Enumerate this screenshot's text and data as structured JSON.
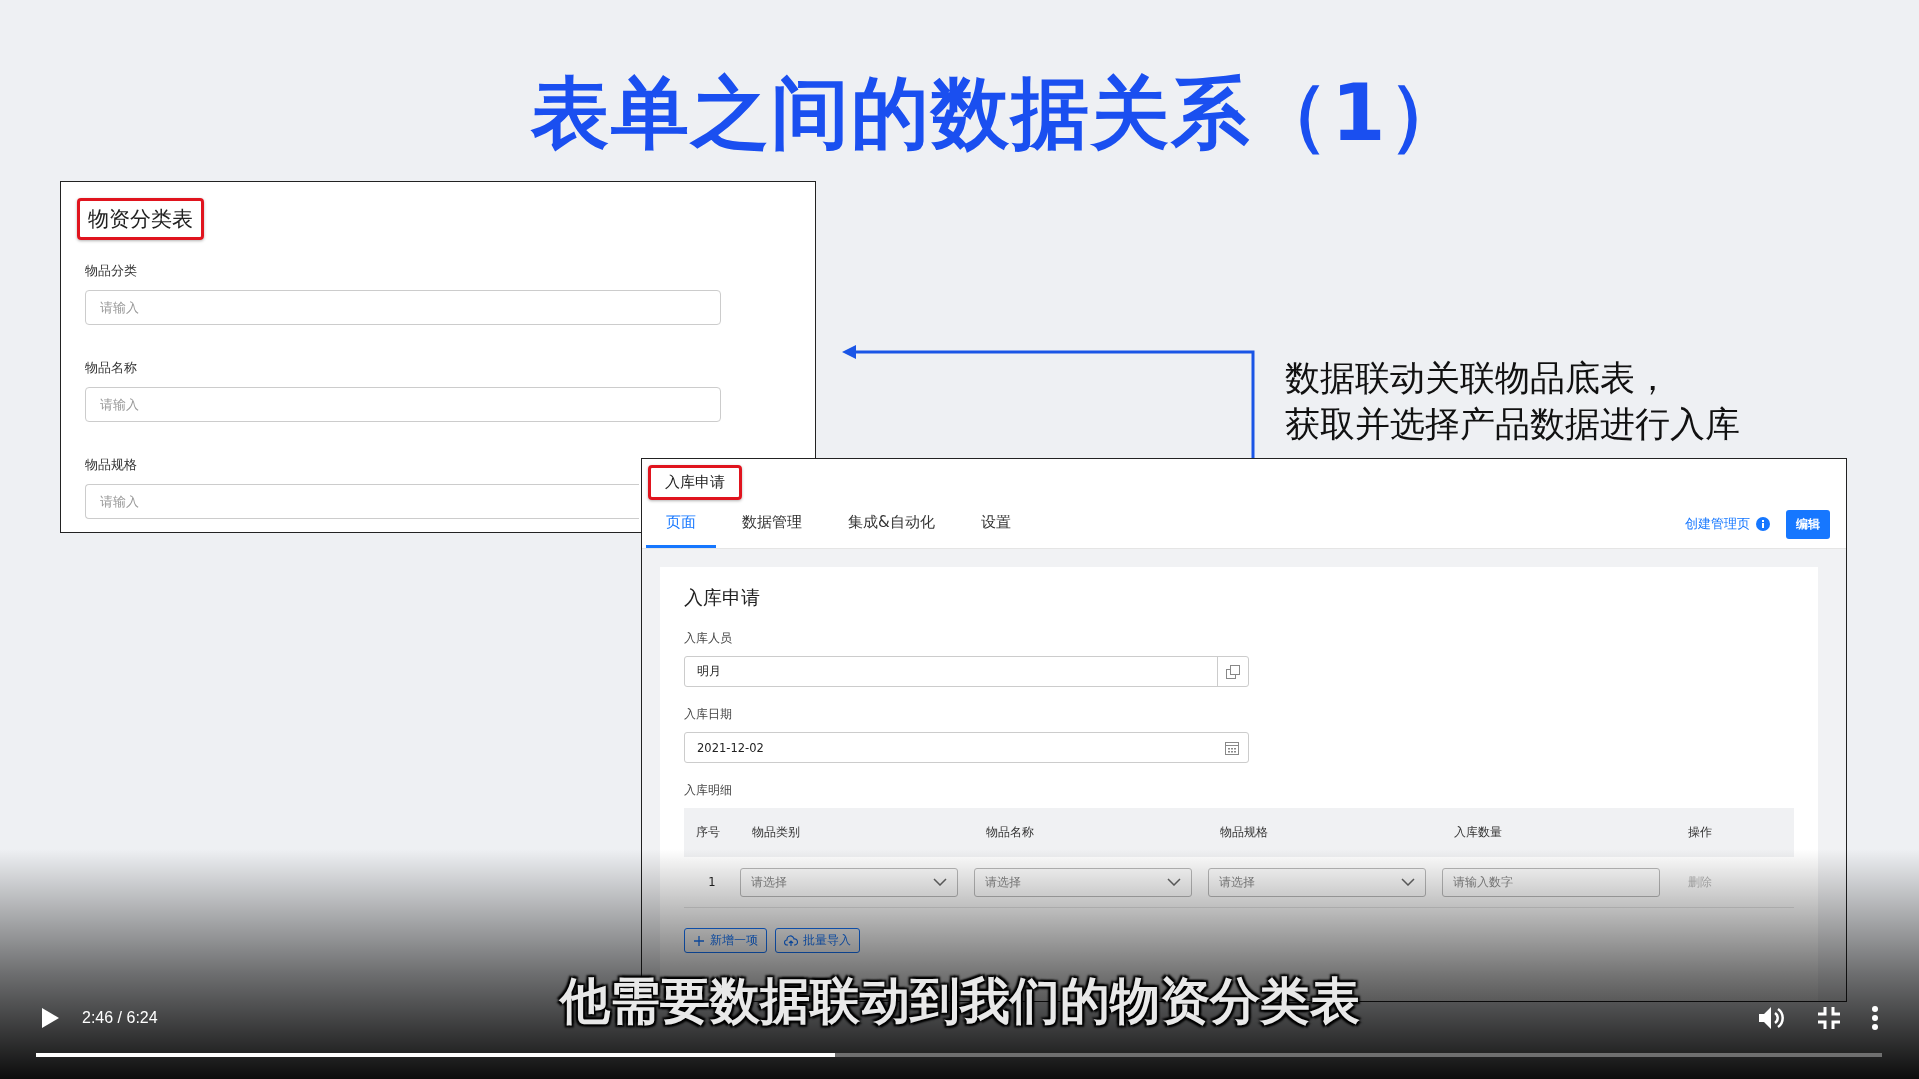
{
  "slide": {
    "title": "表单之间的数据关系（1）",
    "annotation_lines": [
      "数据联动关联物品底表，",
      "获取并选择产品数据进行入库"
    ],
    "source_form": {
      "title": "物资分类表",
      "highlighted": true,
      "fields": [
        {
          "label": "物品分类",
          "placeholder": "请输入"
        },
        {
          "label": "物品名称",
          "placeholder": "请输入"
        },
        {
          "label": "物品规格",
          "placeholder": "请输入"
        }
      ]
    },
    "target_app": {
      "title": "入库申请",
      "highlighted": true,
      "tabs": [
        {
          "label": "页面",
          "selected": true
        },
        {
          "label": "数据管理",
          "selected": false
        },
        {
          "label": "集成&自动化",
          "selected": false
        },
        {
          "label": "设置",
          "selected": false
        }
      ],
      "create_link": "创建管理页",
      "edit_button": "编辑",
      "form": {
        "title": "入库申请",
        "fields": [
          {
            "kind": "picker",
            "label": "入库人员",
            "value": "明月"
          },
          {
            "kind": "date",
            "label": "入库日期",
            "value": "2021-12-02"
          }
        ],
        "table": {
          "label": "入库明细",
          "columns": [
            "序号",
            "物品类别",
            "物品名称",
            "物品规格",
            "入库数量",
            "操作"
          ],
          "rows": [
            {
              "cells": [
                {
                  "kind": "index",
                  "text": "1"
                },
                {
                  "kind": "select",
                  "placeholder": "请选择"
                },
                {
                  "kind": "select",
                  "placeholder": "请选择"
                },
                {
                  "kind": "select",
                  "placeholder": "请选择"
                },
                {
                  "kind": "number",
                  "placeholder": "请输入数字"
                },
                {
                  "kind": "action",
                  "text": "删除",
                  "disabled": true
                }
              ]
            }
          ],
          "buttons": [
            {
              "kind": "add",
              "label": "新增一项"
            },
            {
              "kind": "import",
              "label": "批量导入"
            }
          ]
        }
      }
    }
  },
  "player": {
    "playing": false,
    "time": "2:46 / 6:24",
    "subtitle": "他需要数据联动到我们的物资分类表",
    "progress": {
      "level": 0.433
    }
  }
}
